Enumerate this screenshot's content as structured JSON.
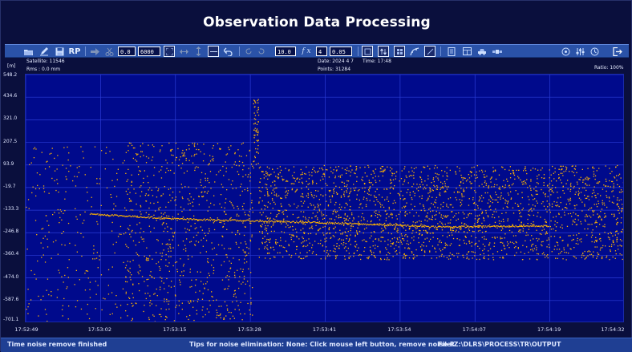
{
  "window": {
    "title": "Observation Data Processing"
  },
  "toolbar": {
    "input_a": "0.0",
    "input_b": "6000",
    "rp_label": "RP",
    "input_scale": "10.0",
    "fx_label": "f x",
    "input_order": "4",
    "input_thresh": "0.05"
  },
  "info": {
    "unit": "[m]",
    "satellite": "Satellite: 11546",
    "rms": "Rms :   0.0 mm",
    "date": "Date: 2024  4  7",
    "time": "Time: 17:48",
    "points": "Points: 31284",
    "ratio": "Ratio: 100%"
  },
  "chart_data": {
    "type": "scatter",
    "yticks": [
      "548.2",
      "434.6",
      "321.0",
      "207.5",
      "93.9",
      "-19.7",
      "-133.3",
      "-246.8",
      "-360.4",
      "-474.0",
      "-587.6",
      "-701.1"
    ],
    "xticks": [
      "17:52:49",
      "17:53:02",
      "17:53:15",
      "17:53:28",
      "17:53:41",
      "17:53:54",
      "17:54:07",
      "17:54:19",
      "17:54:32"
    ],
    "ylim": [
      -701.1,
      548.2
    ],
    "xlim": [
      "17:52:49",
      "17:54:32"
    ],
    "grid": true,
    "series_color": "#ffb400",
    "band_segments": [
      {
        "t0": "17:53:06",
        "t1": "17:53:28",
        "top": 207.5,
        "bottom": -701.1
      },
      {
        "t0": "17:53:28",
        "t1": "17:53:29",
        "top": 430.0,
        "bottom": 80.0
      },
      {
        "t0": "17:53:29",
        "t1": "17:54:32",
        "top": 93.9,
        "bottom": -380.0
      }
    ],
    "trend_line": [
      {
        "x": "17:53:00",
        "y": -150.0
      },
      {
        "x": "17:53:15",
        "y": -175.0
      },
      {
        "x": "17:53:41",
        "y": -195.0
      },
      {
        "x": "17:54:00",
        "y": -215.0
      },
      {
        "x": "17:54:19",
        "y": -210.0
      }
    ]
  },
  "status": {
    "left": "Time noise remove finished",
    "middle": "Tips for noise elimination: None: Click mouse left button, remove noise R",
    "right": "File:Z:\\DLRS\\PROCESS\\TR\\OUTPUT"
  }
}
